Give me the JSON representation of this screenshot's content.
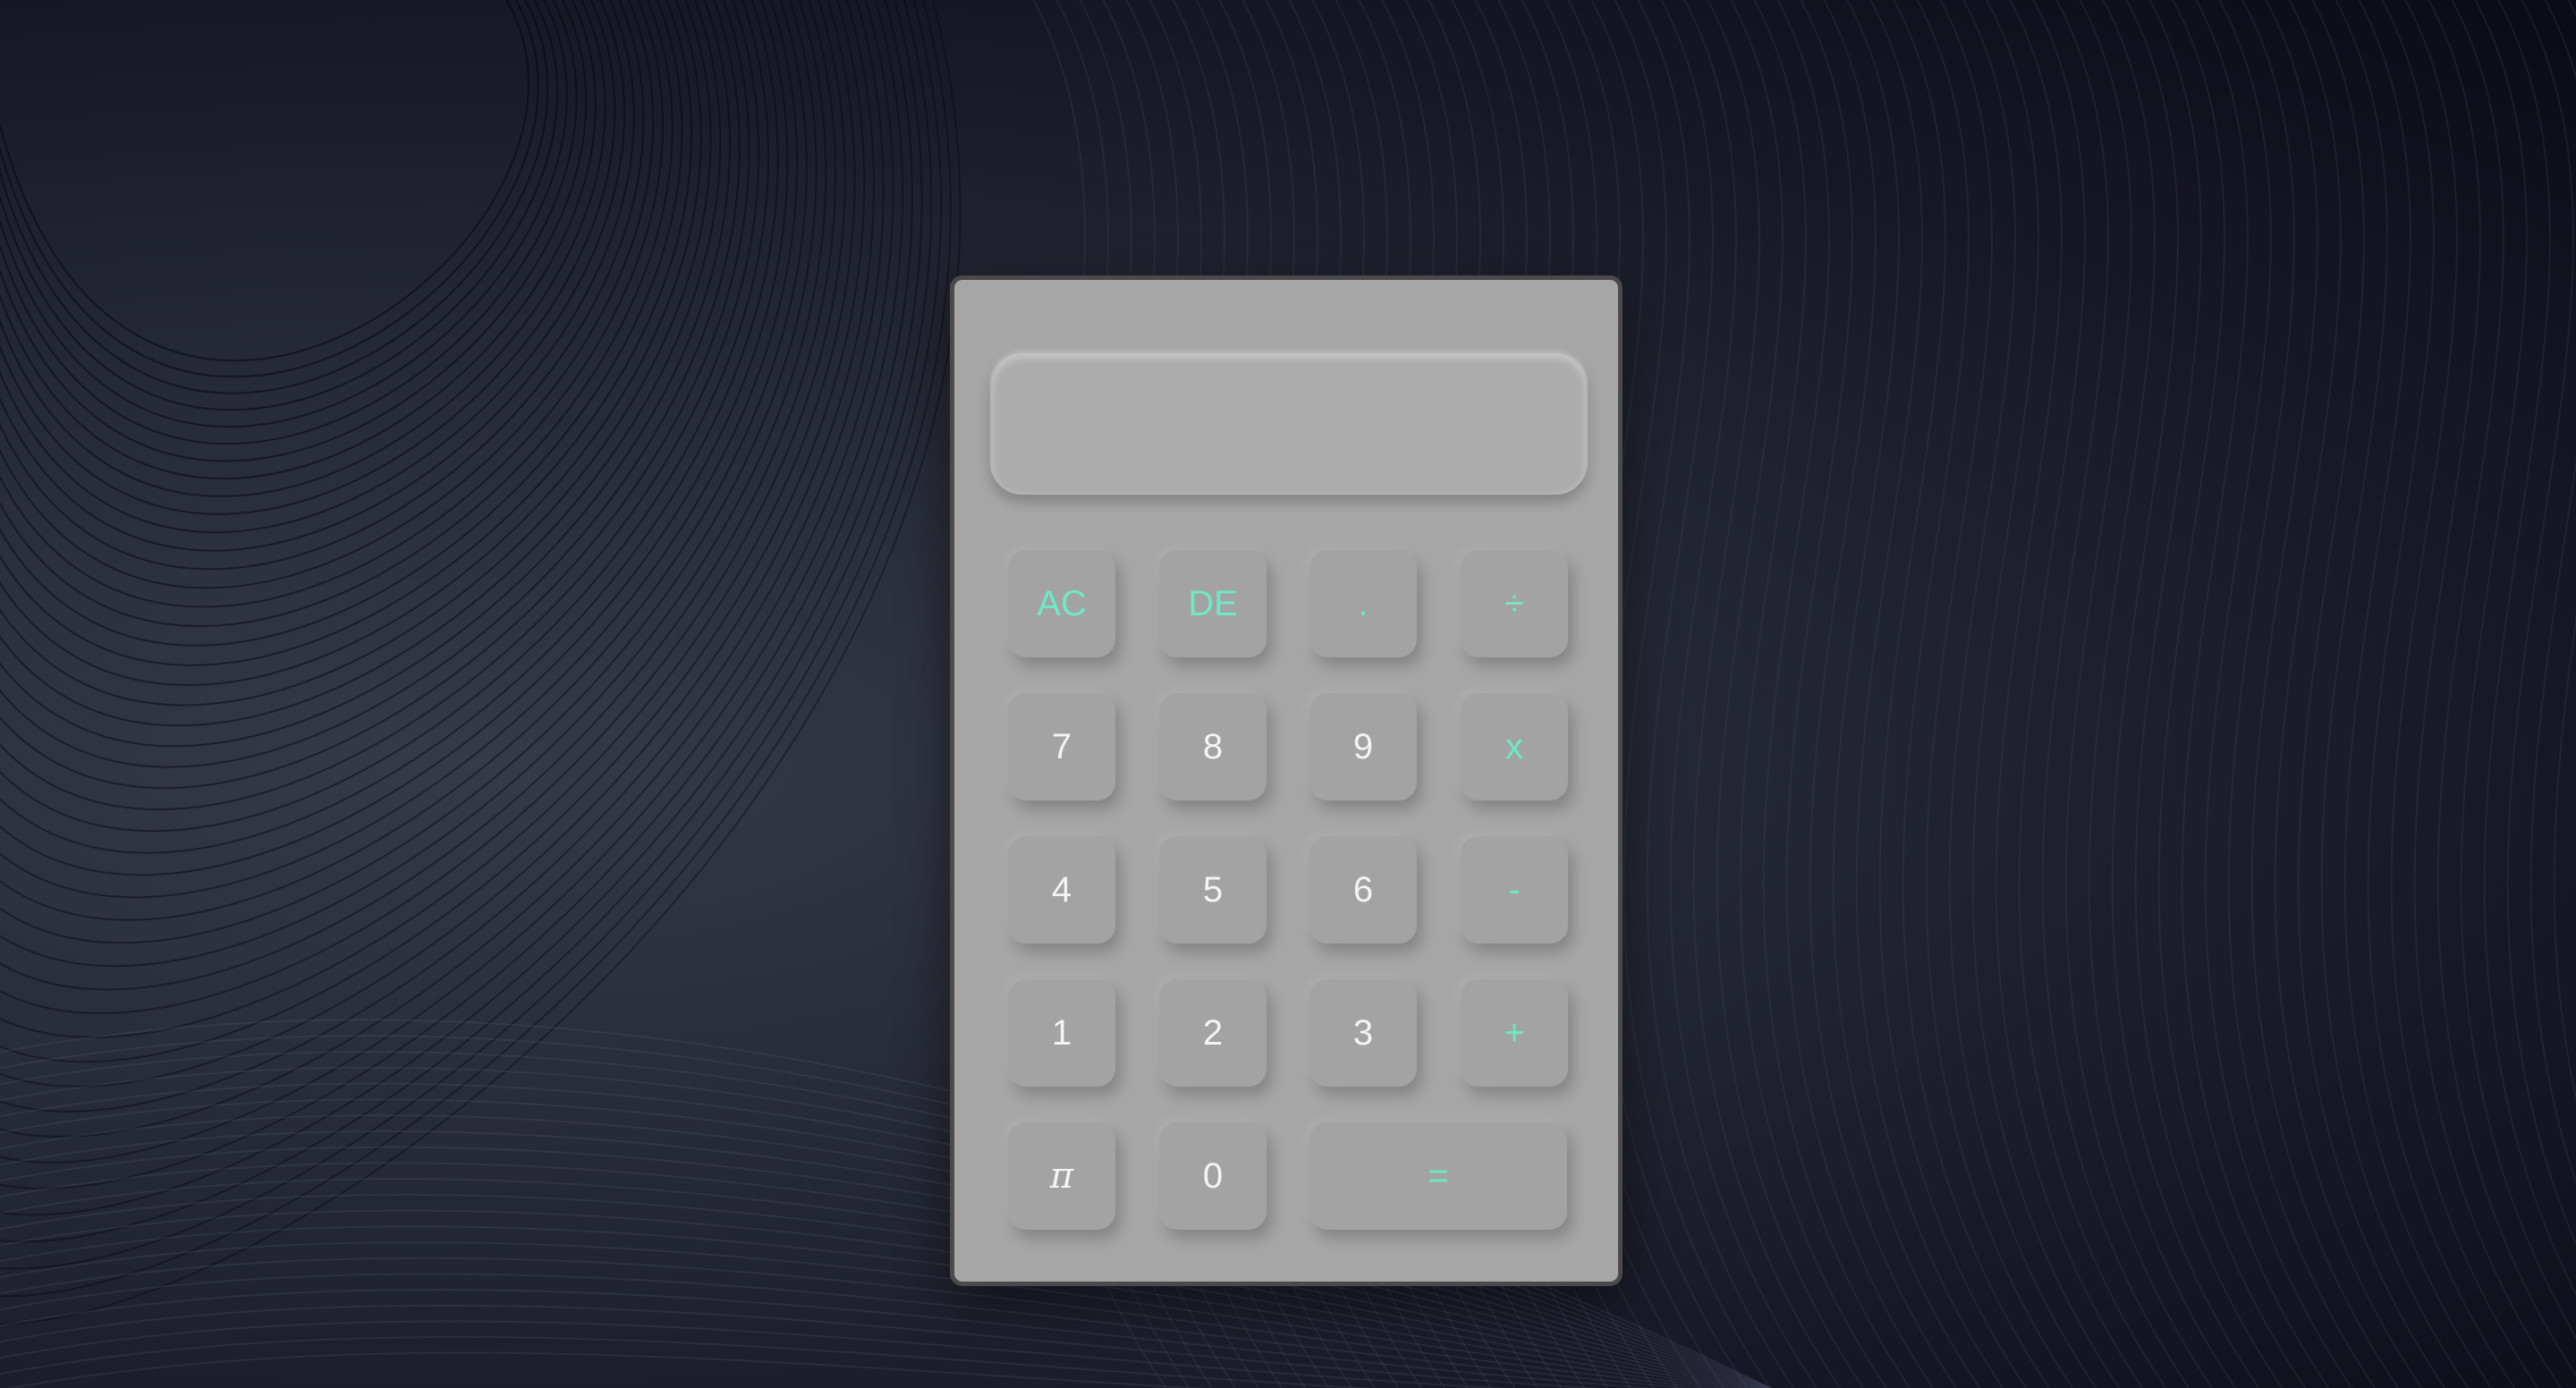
{
  "calculator": {
    "display": "",
    "keys": {
      "ac": "AC",
      "de": "DE",
      "dot": ".",
      "divide": "÷",
      "seven": "7",
      "eight": "8",
      "nine": "9",
      "multiply": "x",
      "four": "4",
      "five": "5",
      "six": "6",
      "minus": "-",
      "one": "1",
      "two": "2",
      "three": "3",
      "plus": "+",
      "pi": "π",
      "zero": "0",
      "equals": "="
    }
  },
  "colors": {
    "accent": "#6fe8c5",
    "calculator_body": "#a6a6a6",
    "key_text": "#f4f4f4",
    "background_dark": "#0b0b17"
  }
}
